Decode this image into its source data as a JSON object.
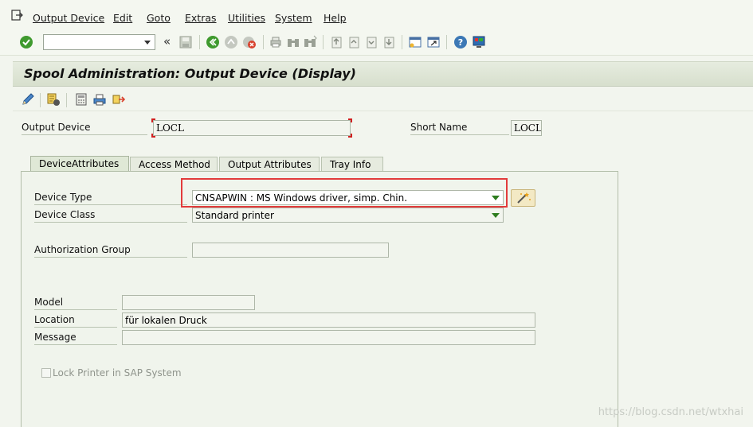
{
  "menu": {
    "items": [
      {
        "label": "Output Device"
      },
      {
        "label": "Edit"
      },
      {
        "label": "Goto"
      },
      {
        "label": "Extras"
      },
      {
        "label": "Utilities"
      },
      {
        "label": "System"
      },
      {
        "label": "Help"
      }
    ]
  },
  "toolbar": {
    "command_value": "",
    "back_glyph": "«"
  },
  "header": {
    "title": "Spool Administration: Output Device (Display)"
  },
  "form": {
    "output_device_label": "Output Device",
    "output_device_value": "LOCL",
    "short_name_label": "Short Name",
    "short_name_value": "LOCL"
  },
  "tabs": [
    {
      "label": "DeviceAttributes"
    },
    {
      "label": "Access Method"
    },
    {
      "label": "Output Attributes"
    },
    {
      "label": "Tray Info"
    }
  ],
  "attributes": {
    "device_type_label": "Device Type",
    "device_type_value": "CNSAPWIN : MS Windows driver, simp. Chin.",
    "device_class_label": "Device Class",
    "device_class_value": "Standard printer",
    "authorization_group_label": "Authorization Group",
    "authorization_group_value": "",
    "model_label": "Model",
    "model_value": "",
    "location_label": "Location",
    "location_value": "für lokalen Druck",
    "message_label": "Message",
    "message_value": "",
    "lock_printer_label": "Lock Printer in SAP System"
  },
  "colors": {
    "highlight": "#e23b3b",
    "accent_green": "#2e7d1f"
  },
  "watermark": "https://blog.csdn.net/wtxhai"
}
